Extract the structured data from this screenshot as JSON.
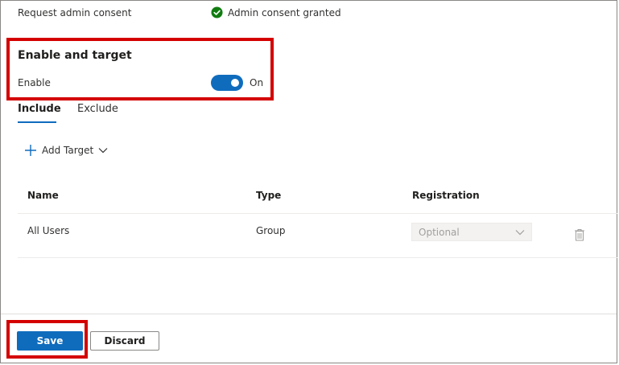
{
  "consent": {
    "label": "Request admin consent",
    "status_text": "Admin consent granted",
    "status_icon": "check-circle-icon",
    "status_color": "#107c10"
  },
  "enable_section": {
    "title": "Enable and target",
    "enable_label": "Enable",
    "toggle_state": "On",
    "toggle_on": true
  },
  "tabs": [
    {
      "label": "Include",
      "selected": true
    },
    {
      "label": "Exclude",
      "selected": false
    }
  ],
  "add_target": {
    "label": "Add Target",
    "icon": "plus-icon",
    "chevron": "chevron-down-icon"
  },
  "table": {
    "headers": [
      "Name",
      "Type",
      "Registration"
    ],
    "rows": [
      {
        "name": "All Users",
        "type": "Group",
        "registration": "Optional"
      }
    ]
  },
  "footer": {
    "save_label": "Save",
    "discard_label": "Discard"
  },
  "colors": {
    "accent": "#0f6cbd",
    "highlight": "#d40000"
  }
}
